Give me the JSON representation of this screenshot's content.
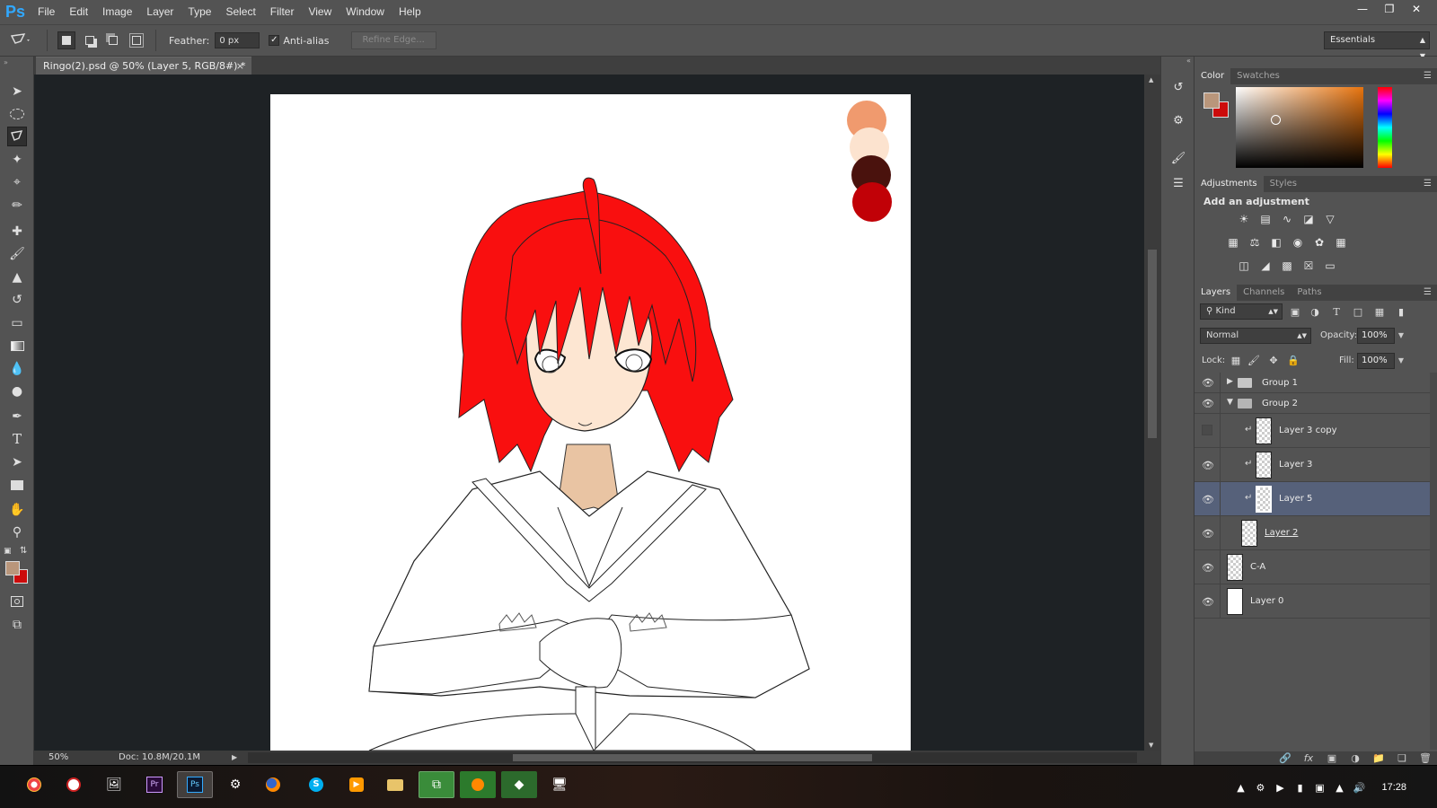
{
  "app": {
    "logo": "Ps",
    "menus": [
      "File",
      "Edit",
      "Image",
      "Layer",
      "Type",
      "Select",
      "Filter",
      "View",
      "Window",
      "Help"
    ],
    "window_controls": [
      "minimize-icon",
      "restore-icon",
      "close-icon"
    ]
  },
  "options": {
    "tool_icon": "polygonal-lasso-icon",
    "feather_label": "Feather:",
    "feather_value": "0 px",
    "antialias_label": "Anti-alias",
    "antialias_checked": true,
    "refine_edge_label": "Refine Edge...",
    "workspace": "Essentials"
  },
  "document": {
    "tab_title": "Ringo(2).psd @ 50% (Layer 5, RGB/8#) *",
    "tab_close": "×",
    "zoom": "50%",
    "doc_size": "Doc: 10.8M/20.1M",
    "palette": [
      "#f09a6e",
      "#fce3cf",
      "#4a120d",
      "#c10107"
    ],
    "hair_color": "#f90f0f",
    "skin_color": "#fde6d2"
  },
  "tools": [
    "move-icon",
    "elliptical-marquee-icon",
    "polygonal-lasso-icon",
    "magic-wand-icon",
    "crop-icon",
    "eyedropper-icon",
    "healing-brush-icon",
    "brush-icon",
    "clone-stamp-icon",
    "history-brush-icon",
    "eraser-icon",
    "gradient-icon",
    "blur-icon",
    "dodge-icon",
    "pen-icon",
    "type-icon",
    "path-selection-icon",
    "rectangle-icon",
    "hand-icon",
    "zoom-icon",
    "quick-mask-icon",
    "screen-mode-icon"
  ],
  "colors": {
    "foreground": "#b9967b",
    "background": "#cc0b0b"
  },
  "color_panel": {
    "tabs": [
      "Color",
      "Swatches"
    ]
  },
  "adjustments_panel": {
    "tabs": [
      "Adjustments",
      "Styles"
    ],
    "title": "Add an adjustment"
  },
  "layers_panel": {
    "tabs": [
      "Layers",
      "Channels",
      "Paths"
    ],
    "kind_filter": "Kind",
    "blend_mode": "Normal",
    "opacity_label": "Opacity:",
    "opacity": "100%",
    "lock_label": "Lock:",
    "fill_label": "Fill:",
    "fill": "100%",
    "layers": [
      {
        "name": "Group 1",
        "type": "group",
        "visible": true,
        "expanded": false
      },
      {
        "name": "Group 2",
        "type": "group",
        "visible": true,
        "expanded": true
      },
      {
        "name": "Layer 3 copy",
        "type": "layer",
        "visible": false,
        "clipped": true
      },
      {
        "name": "Layer 3",
        "type": "layer",
        "visible": true,
        "clipped": true
      },
      {
        "name": "Layer 5",
        "type": "layer",
        "visible": true,
        "clipped": true,
        "selected": true
      },
      {
        "name": "Layer 2",
        "type": "layer",
        "visible": true
      },
      {
        "name": "C-A",
        "type": "layer",
        "visible": true
      },
      {
        "name": "Layer 0",
        "type": "layer",
        "visible": true
      }
    ]
  },
  "taskbar": {
    "time": "17:28",
    "apps": [
      "chrome-icon",
      "app-icon",
      "image-viewer-icon",
      "premiere-icon",
      "photoshop-icon",
      "paint-icon",
      "firefox-icon",
      "skype-icon",
      "media-player-icon",
      "file-explorer-icon",
      "visual-studio-icon",
      "avast-icon",
      "layers-app-icon",
      "screen-capture-icon"
    ]
  }
}
